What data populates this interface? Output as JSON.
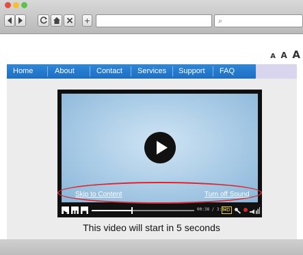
{
  "browser": {
    "toolbar_buttons": [
      "back-icon",
      "forward-icon",
      "reload-icon",
      "home-icon",
      "stop-icon"
    ],
    "new_tab_label": "+",
    "search_icon_glyph": "⌕"
  },
  "text_size": {
    "small": "A",
    "medium": "A",
    "large": "A"
  },
  "nav": {
    "items": [
      "Home",
      "About",
      "Contact",
      "Services",
      "Support",
      "FAQ"
    ]
  },
  "video": {
    "skip_link": "Skip to Content",
    "sound_link": "Turn off Sound",
    "time": "00:38 / 3:02",
    "hd_label": "HD",
    "progress": 0.39,
    "caption": "This video will start in 5 seconds"
  },
  "colors": {
    "nav_blue": "#2a7fd3",
    "highlight_red": "#d9262e",
    "video_sky": "#a9cbe6"
  }
}
